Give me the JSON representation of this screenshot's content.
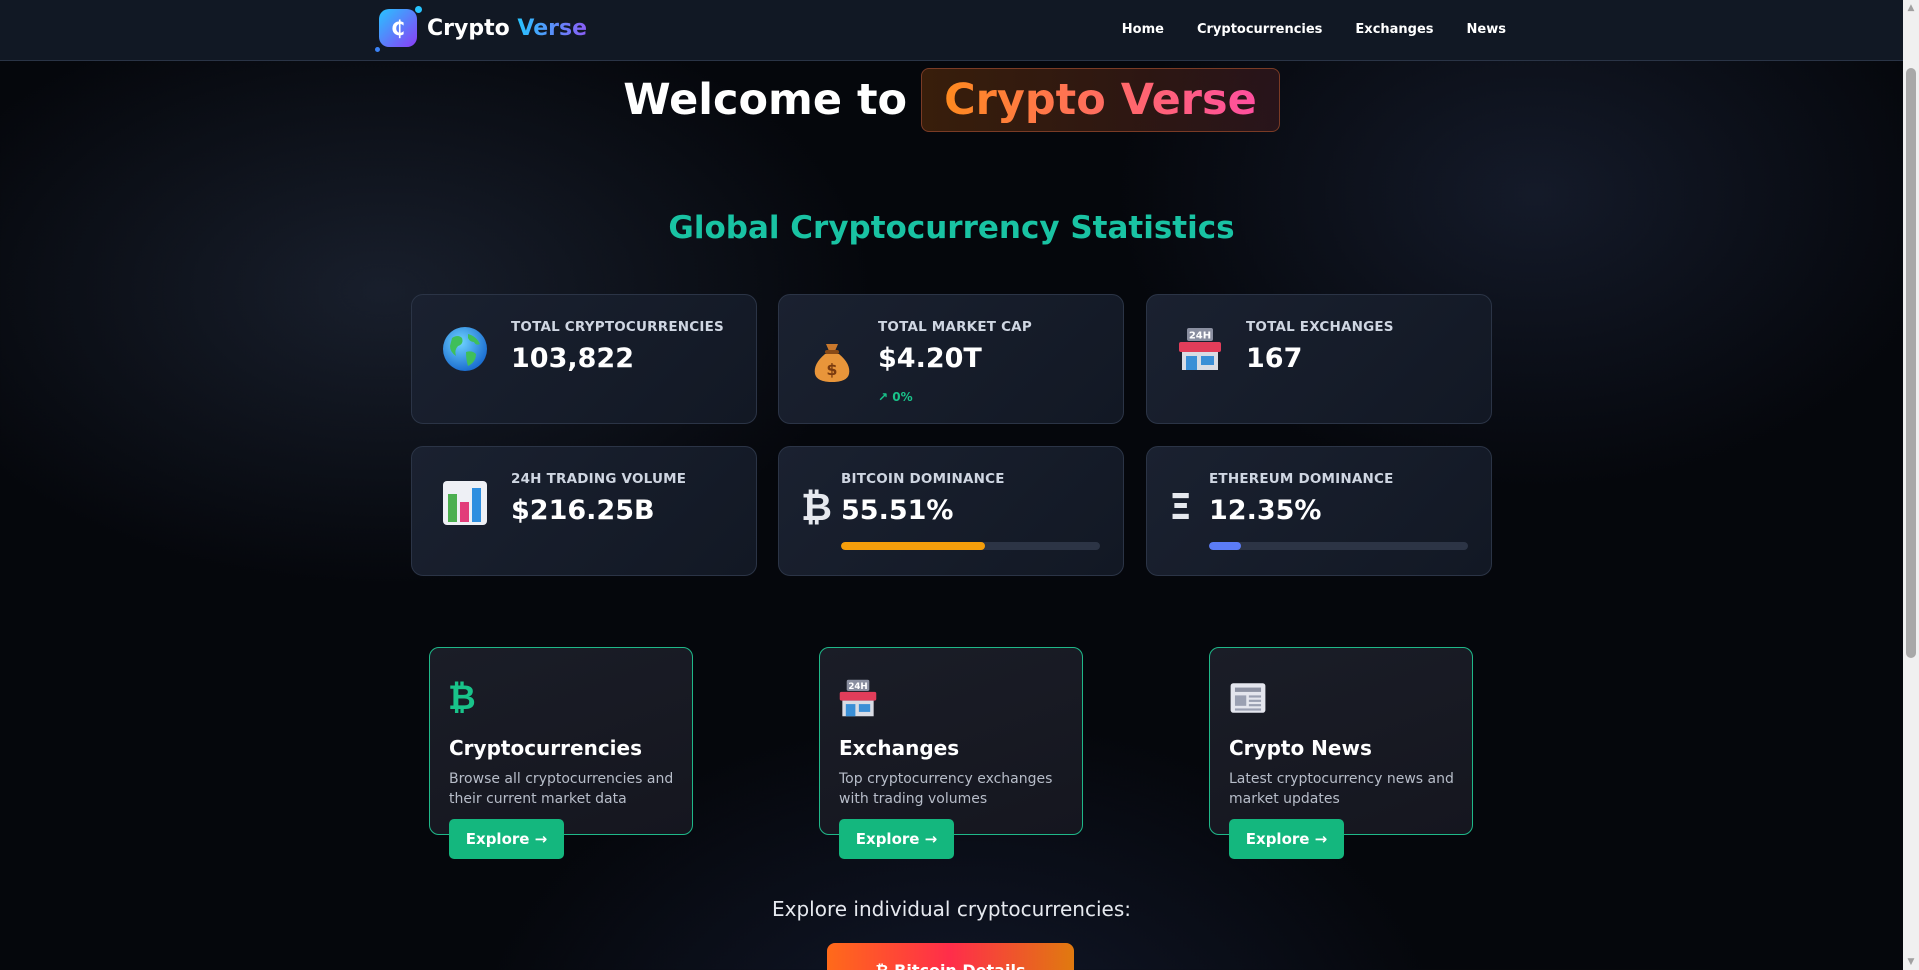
{
  "nav": {
    "logo_symbol": "₵",
    "brand_part1": "Crypto",
    "brand_part2": "Verse",
    "links": [
      "Home",
      "Cryptocurrencies",
      "Exchanges",
      "News"
    ]
  },
  "hero": {
    "prefix": "Welcome to",
    "brand": "Crypto Verse"
  },
  "stats_section": {
    "title": "Global Cryptocurrency Statistics",
    "cards": [
      {
        "icon": "globe-icon",
        "label": "TOTAL CRYPTOCURRENCIES",
        "value": "103,822"
      },
      {
        "icon": "money-bag-icon",
        "label": "TOTAL MARKET CAP",
        "value": "$4.20T",
        "change": "↗ 0%"
      },
      {
        "icon": "exchange-store-icon",
        "label": "TOTAL EXCHANGES",
        "value": "167"
      },
      {
        "icon": "bar-chart-icon",
        "label": "24H TRADING VOLUME",
        "value": "$216.25B"
      },
      {
        "icon": "bitcoin-icon",
        "symbol": "₿",
        "label": "BITCOIN DOMINANCE",
        "value": "55.51%",
        "progress": 0.5551,
        "color": "#f59e0b"
      },
      {
        "icon": "ethereum-icon",
        "symbol": "Ξ",
        "label": "ETHEREUM DOMINANCE",
        "value": "12.35%",
        "progress": 0.1235,
        "color": "#5b7cf6"
      }
    ]
  },
  "features": [
    {
      "icon": "bitcoin-icon",
      "symbol": "₿",
      "title": "Cryptocurrencies",
      "desc": "Browse all cryptocurrencies and their current market data",
      "button": "Explore →"
    },
    {
      "icon": "exchange-store-icon",
      "title": "Exchanges",
      "desc": "Top cryptocurrency exchanges with trading volumes",
      "button": "Explore →"
    },
    {
      "icon": "newspaper-icon",
      "title": "Crypto News",
      "desc": "Latest cryptocurrency news and market updates",
      "button": "Explore →"
    }
  ],
  "explore": {
    "text": "Explore individual cryptocurrencies:",
    "button": "₿ Bitcoin Details"
  },
  "colors": {
    "accent_teal": "#19c3a3",
    "button_green": "#14b77e",
    "hero_gradient_start": "#ff8a1f",
    "hero_gradient_end": "#ff4fa0"
  }
}
